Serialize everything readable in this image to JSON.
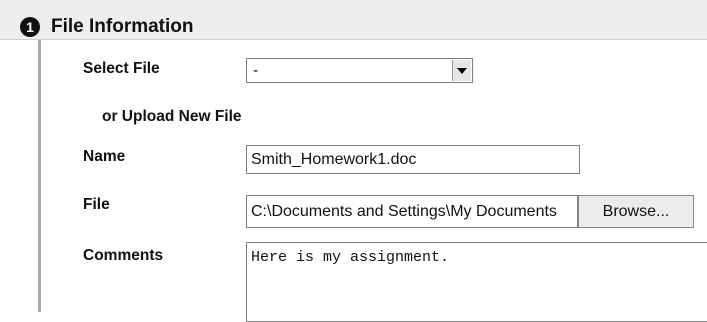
{
  "section": {
    "step_number": "1",
    "title": "File Information"
  },
  "form": {
    "select_file_label": "Select File",
    "select_file_value": "-",
    "upload_label": "or Upload New File",
    "name_label": "Name",
    "name_value": "Smith_Homework1.doc",
    "file_label": "File",
    "file_value": "C:\\Documents and Settings\\My Documents",
    "browse_label": "Browse...",
    "comments_label": "Comments",
    "comments_value": "Here is my assignment."
  },
  "icons": {
    "step_badge": "numbered-circle-icon",
    "dropdown": "chevron-down-icon"
  }
}
